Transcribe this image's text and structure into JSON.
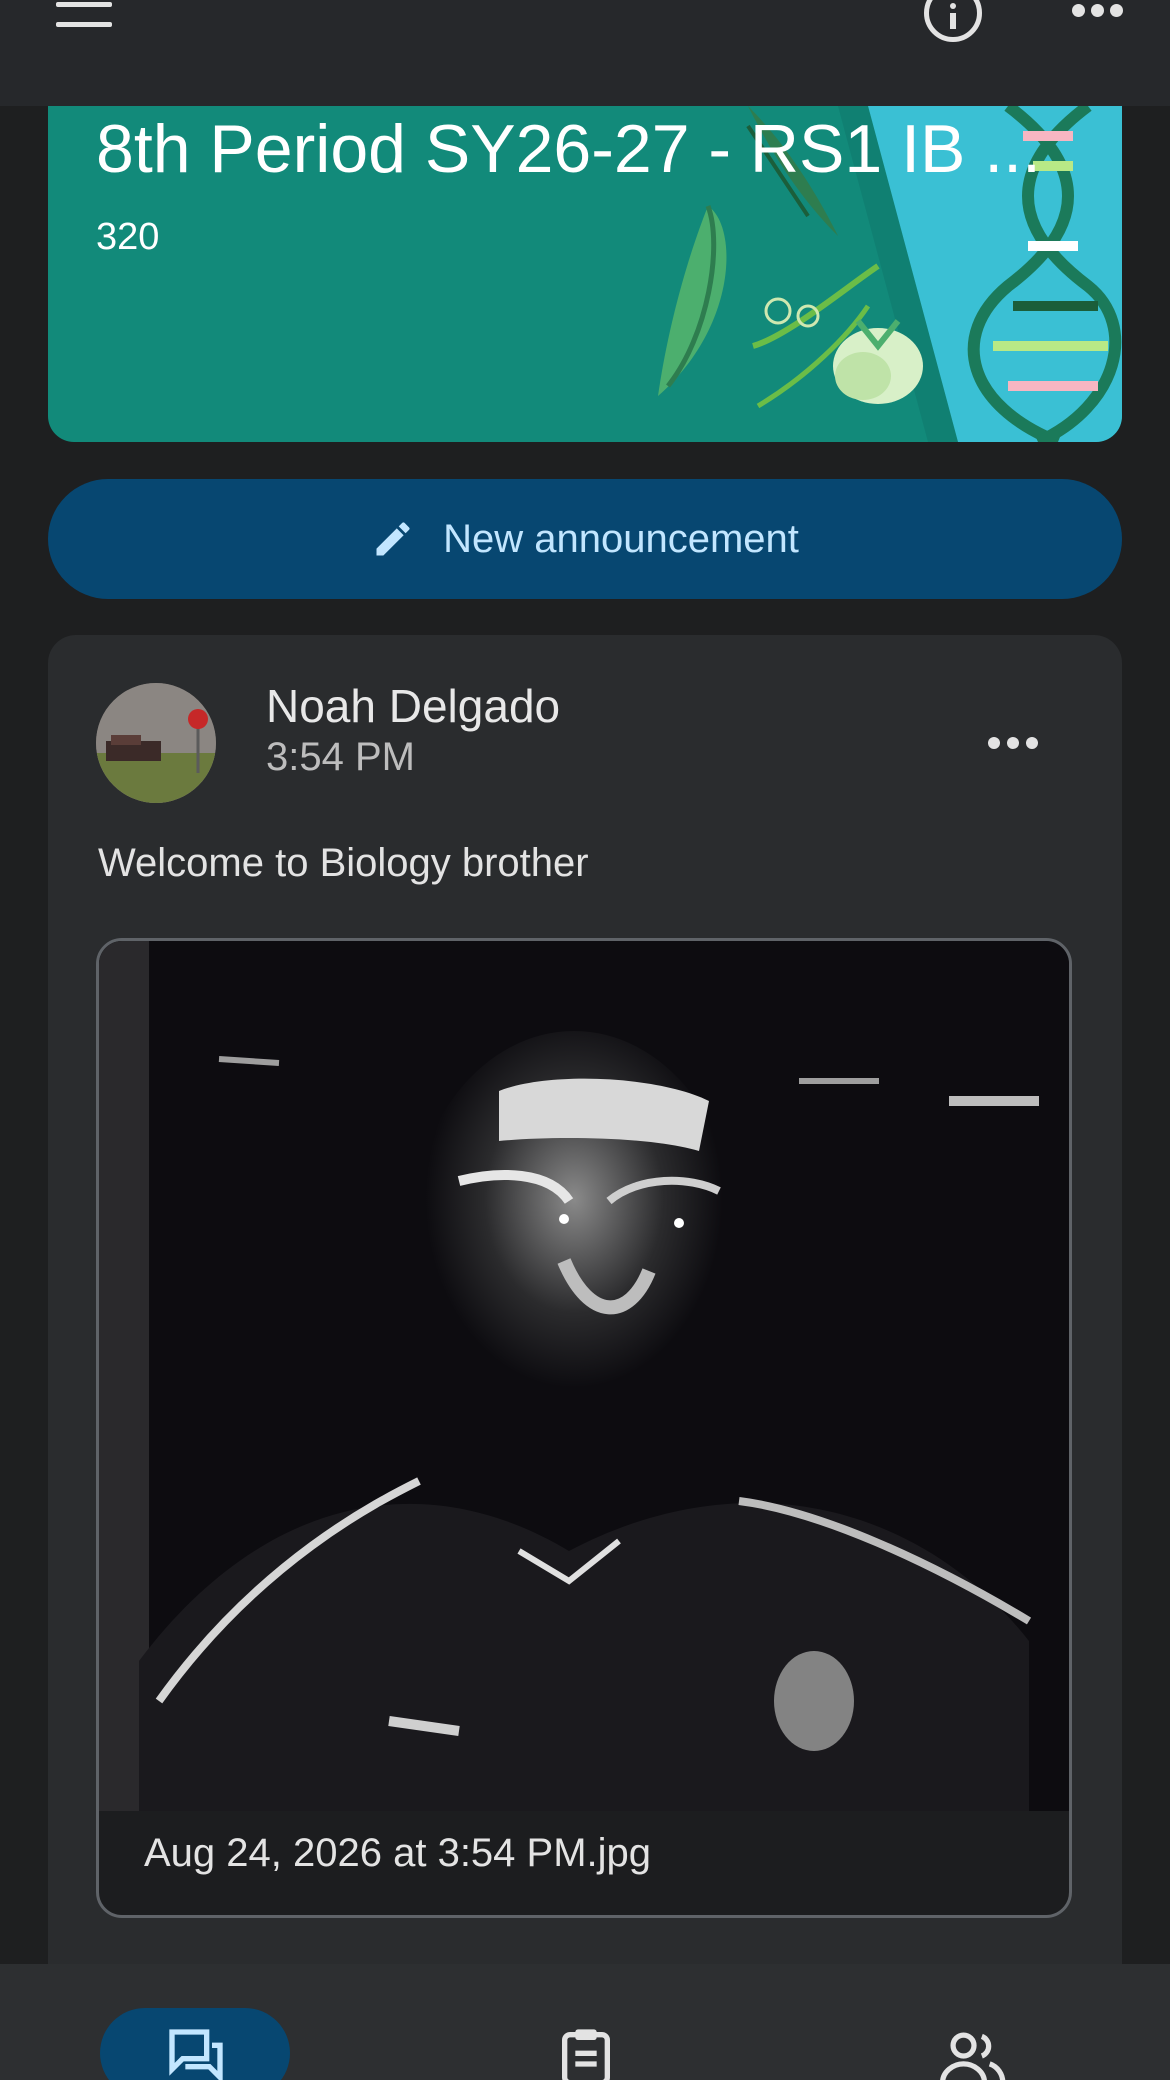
{
  "header": {
    "menu_icon": "hamburger-menu-icon",
    "info_icon": "info-icon",
    "more_icon": "more-horiz-icon"
  },
  "banner": {
    "title": "8th Period SY26-27 - RS1 IB ...",
    "room": "320",
    "colors": {
      "background": "#128a7a",
      "accent": "#3ac0d4"
    }
  },
  "actions": {
    "new_announcement": "New announcement",
    "icon": "pencil-icon"
  },
  "post": {
    "author": "Noah Delgado",
    "time": "3:54 PM",
    "text": "Welcome to Biology brother",
    "attachment": {
      "filename": "Aug 24, 2026 at 3:54 PM.jpg"
    }
  },
  "bottom_nav": {
    "items": [
      {
        "icon": "stream-chat-icon",
        "selected": true
      },
      {
        "icon": "classwork-clipboard-icon",
        "selected": false
      },
      {
        "icon": "people-icon",
        "selected": false
      }
    ]
  }
}
